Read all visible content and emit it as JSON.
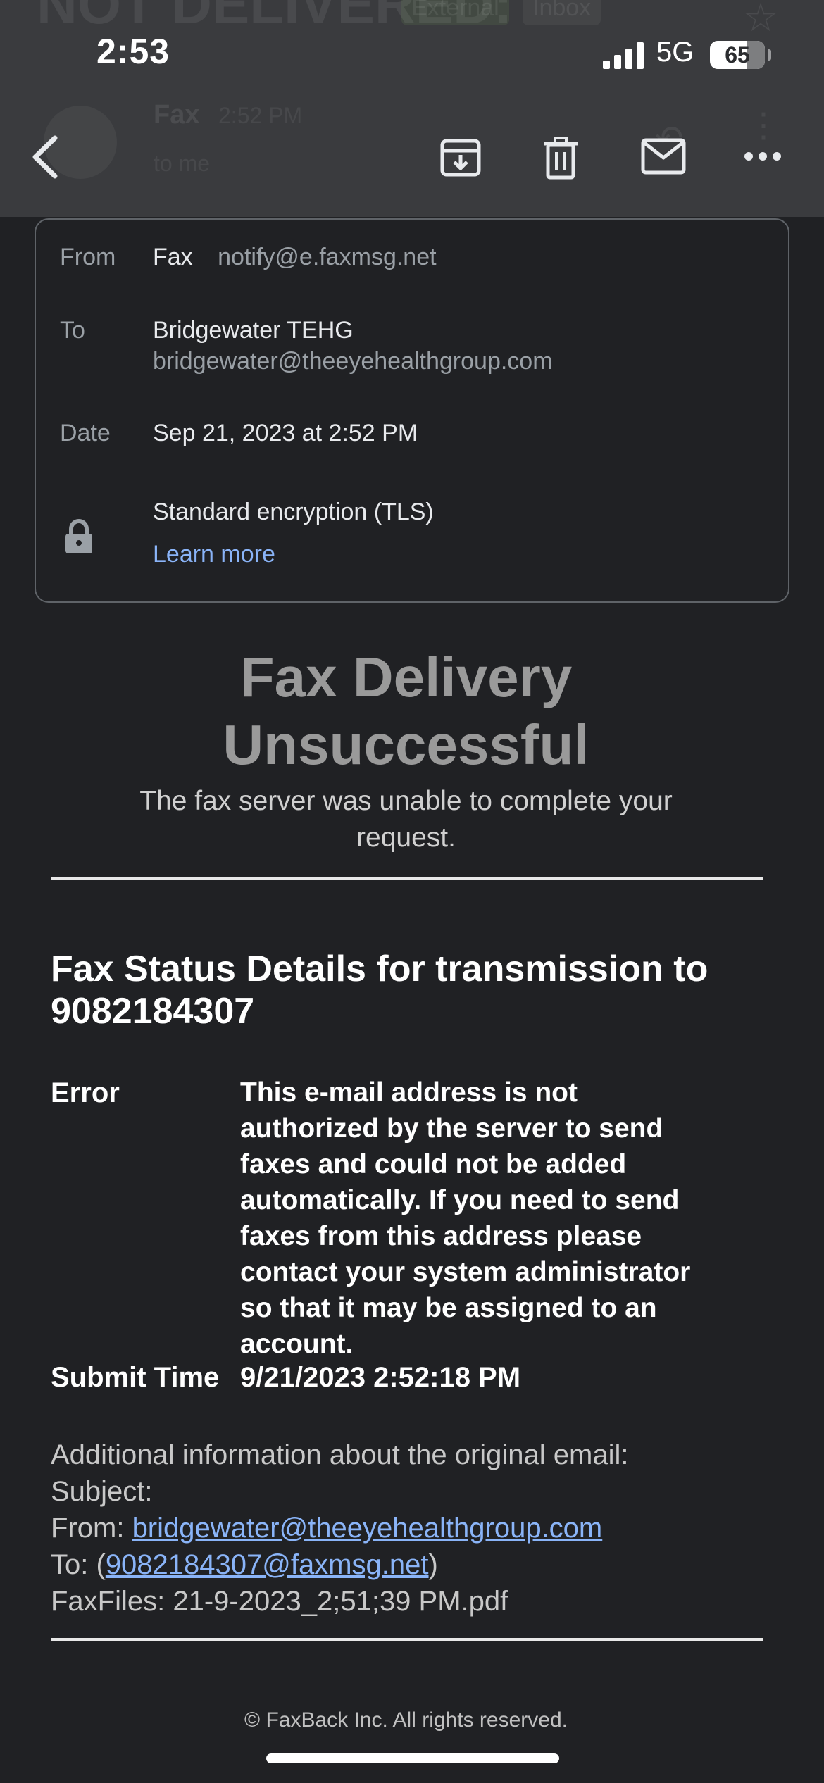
{
  "status_bar": {
    "time": "2:53",
    "network": "5G",
    "battery": "65"
  },
  "behind_header": {
    "subject": "NOT DELIVERED:",
    "tag_external": "External",
    "tag_inbox": "Inbox",
    "sender": "Fax",
    "time": "2:52 PM",
    "recipient": "to me"
  },
  "details": {
    "from_label": "From",
    "from_name": "Fax",
    "from_email": "notify@e.faxmsg.net",
    "to_label": "To",
    "to_name": "Bridgewater TEHG",
    "to_email": "bridgewater@theeyehealthgroup.com",
    "date_label": "Date",
    "date_value": "Sep 21, 2023 at 2:52 PM",
    "encryption": "Standard encryption (TLS)",
    "learn_more": "Learn more"
  },
  "body": {
    "heading_line1": "Fax Delivery",
    "heading_line2": "Unsuccessful",
    "lead_line1": "The fax server was unable to complete your",
    "lead_line2": "request.",
    "status_title_line1": "Fax Status Details for transmission to",
    "status_title_line2": "9082184307",
    "error_label": "Error",
    "error_lines": [
      "This e-mail address is not",
      "authorized by the server to send",
      "faxes and could not be added",
      "automatically. If you need to send",
      "faxes from this address please",
      "contact your system administrator",
      "so that it may be assigned to an",
      "account."
    ],
    "submit_label": "Submit Time",
    "submit_value": "9/21/2023 2:52:18 PM",
    "additional_info": "Additional information about the original email:",
    "subject_label": "Subject:",
    "from_label": "From:",
    "from_link": "bridgewater@theeyehealthgroup.com",
    "to_label": "To:",
    "to_open": "(",
    "to_link": "9082184307@faxmsg.net",
    "to_close": ")",
    "faxfiles": "FaxFiles: 21-9-2023_2;51;39 PM.pdf",
    "footer": "© FaxBack Inc. All rights reserved."
  }
}
